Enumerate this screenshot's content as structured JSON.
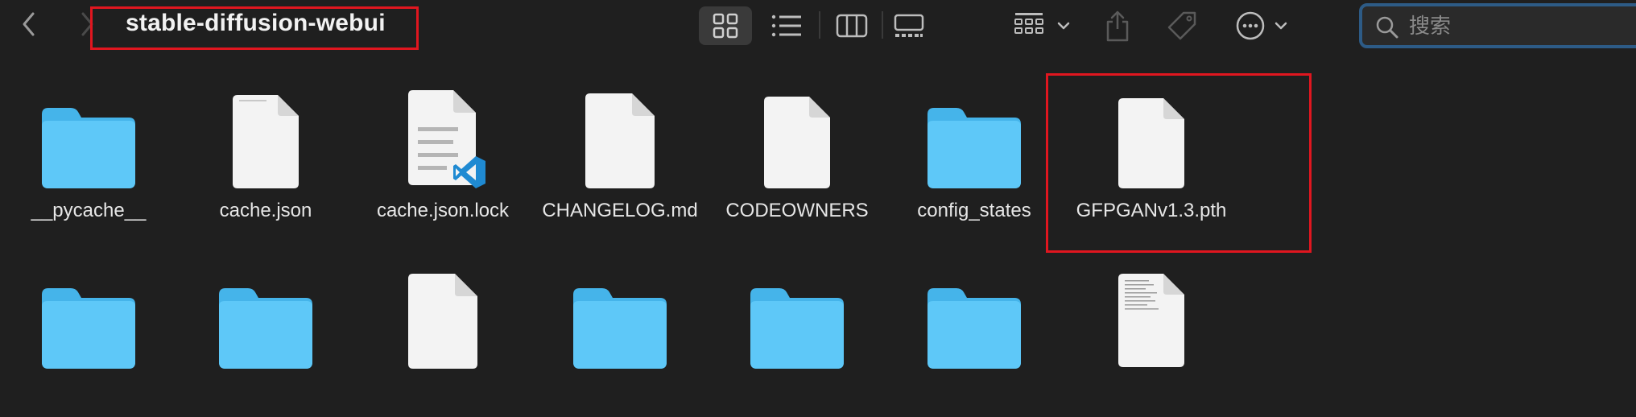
{
  "window": {
    "title": "stable-diffusion-webui"
  },
  "toolbar": {
    "back_icon": "chevron-left-icon",
    "forward_icon": "chevron-right-icon",
    "views": [
      "icon-view",
      "list-view",
      "column-view",
      "gallery-view"
    ],
    "active_view": "icon-view",
    "group_icon": "group-by-icon",
    "share_icon": "share-icon",
    "tag_icon": "tag-icon",
    "more_icon": "more-icon"
  },
  "search": {
    "placeholder": "搜索"
  },
  "files": [
    {
      "name": "__pycache__",
      "kind": "folder"
    },
    {
      "name": "cache.json",
      "kind": "file"
    },
    {
      "name": "cache.json.lock",
      "kind": "vscode-file"
    },
    {
      "name": "CHANGELOG.md",
      "kind": "file"
    },
    {
      "name": "CODEOWNERS",
      "kind": "file"
    },
    {
      "name": "config_states",
      "kind": "folder"
    },
    {
      "name": "GFPGANv1.3.pth",
      "kind": "file"
    }
  ],
  "row2": [
    "folder",
    "folder",
    "file",
    "folder",
    "folder",
    "folder",
    "text-file"
  ],
  "colors": {
    "background": "#1f1f1f",
    "folder": "#5ec8f8",
    "highlight": "#e0161f",
    "search_border": "#2d5b86"
  }
}
